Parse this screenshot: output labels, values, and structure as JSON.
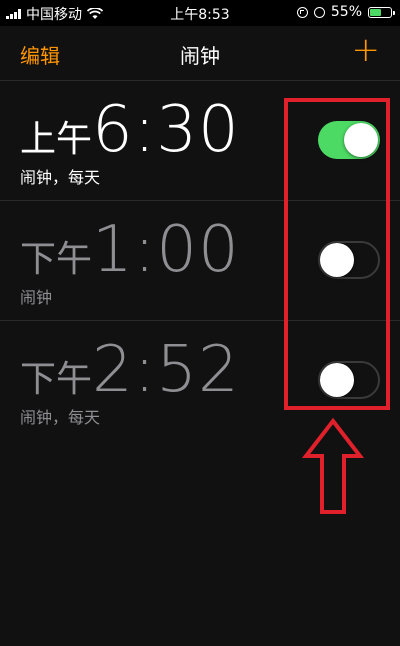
{
  "status_bar": {
    "carrier": "中国移动",
    "time": "上午8:53",
    "battery_percent": "55%",
    "battery_level": 0.55
  },
  "nav": {
    "edit": "编辑",
    "title": "闹钟",
    "add": "+"
  },
  "alarms": [
    {
      "ampm": "上午",
      "time": "6:30",
      "label": "闹钟，每天",
      "enabled": true
    },
    {
      "ampm": "下午",
      "time": "1:00",
      "label": "闹钟",
      "enabled": false
    },
    {
      "ampm": "下午",
      "time": "2:52",
      "label": "闹钟，每天",
      "enabled": false
    }
  ],
  "colors": {
    "accent": "#ff9500",
    "toggle_on": "#4cd964",
    "annotation": "#e0202a"
  }
}
